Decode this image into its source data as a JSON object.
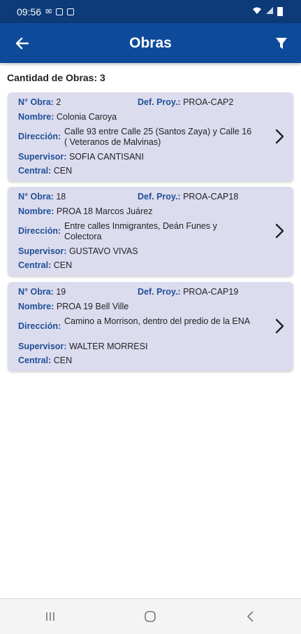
{
  "status": {
    "time": "09:56"
  },
  "header": {
    "title": "Obras"
  },
  "summary": {
    "label": "Cantidad de Obras: 3"
  },
  "labels": {
    "obra": "N° Obra:",
    "proy": "Def. Proy.:",
    "nombre": "Nombre:",
    "direccion": "Dirección:",
    "supervisor": "Supervisor:",
    "central": "Central:"
  },
  "obras": [
    {
      "numero": "2",
      "proyecto": "PROA-CAP2",
      "nombre": "Colonia Caroya",
      "direccion": "Calle 93 entre Calle 25 (Santos Zaya) y Calle 16 ( Veteranos de Malvinas)",
      "supervisor": "SOFIA CANTISANI",
      "central": "CEN"
    },
    {
      "numero": "18",
      "proyecto": "PROA-CAP18",
      "nombre": "PROA 18 Marcos Juárez",
      "direccion": "Entre calles Inmigrantes, Deán Funes y Colectora",
      "supervisor": "GUSTAVO VIVAS",
      "central": "CEN"
    },
    {
      "numero": "19",
      "proyecto": "PROA-CAP19",
      "nombre": "PROA 19 Bell Ville",
      "direccion": "Camino a Morrison,  dentro del predio de la ENA",
      "supervisor": "WALTER MORRESI",
      "central": "CEN"
    }
  ],
  "colors": {
    "status_bar": "#0d3a78",
    "app_bar": "#0d4a9a",
    "card": "#dcdcef",
    "label": "#1f4f96"
  }
}
